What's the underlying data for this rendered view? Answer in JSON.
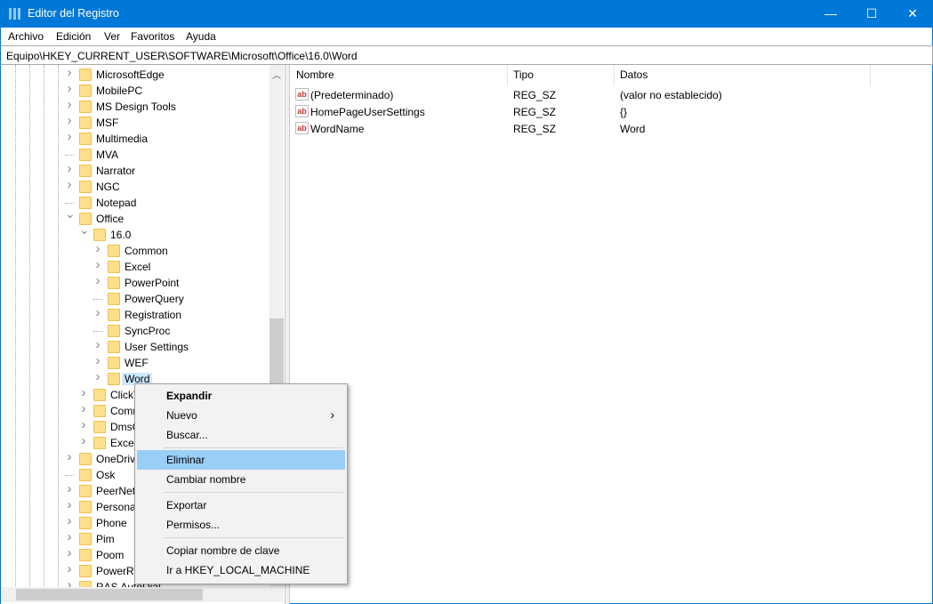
{
  "window": {
    "title": "Editor del Registro",
    "minimize": "—",
    "maximize": "☐",
    "close": "✕"
  },
  "menu": [
    "Archivo",
    "Edición",
    "Ver",
    "Favoritos",
    "Ayuda"
  ],
  "address": "Equipo\\HKEY_CURRENT_USER\\SOFTWARE\\Microsoft\\Office\\16.0\\Word",
  "tree": [
    {
      "label": "MicrosoftEdge",
      "level": 0,
      "exp": ">"
    },
    {
      "label": "MobilePC",
      "level": 0,
      "exp": ">"
    },
    {
      "label": "MS Design Tools",
      "level": 0,
      "exp": ">"
    },
    {
      "label": "MSF",
      "level": 0,
      "exp": ">"
    },
    {
      "label": "Multimedia",
      "level": 0,
      "exp": ">"
    },
    {
      "label": "MVA",
      "level": 0,
      "exp": ""
    },
    {
      "label": "Narrator",
      "level": 0,
      "exp": ">"
    },
    {
      "label": "NGC",
      "level": 0,
      "exp": ">"
    },
    {
      "label": "Notepad",
      "level": 0,
      "exp": ""
    },
    {
      "label": "Office",
      "level": 0,
      "exp": "v"
    },
    {
      "label": "16.0",
      "level": 1,
      "exp": "v"
    },
    {
      "label": "Common",
      "level": 2,
      "exp": ">"
    },
    {
      "label": "Excel",
      "level": 2,
      "exp": ">"
    },
    {
      "label": "PowerPoint",
      "level": 2,
      "exp": ">"
    },
    {
      "label": "PowerQuery",
      "level": 2,
      "exp": ""
    },
    {
      "label": "Registration",
      "level": 2,
      "exp": ">"
    },
    {
      "label": "SyncProc",
      "level": 2,
      "exp": ""
    },
    {
      "label": "User Settings",
      "level": 2,
      "exp": ">"
    },
    {
      "label": "WEF",
      "level": 2,
      "exp": ">"
    },
    {
      "label": "Word",
      "level": 2,
      "exp": ">",
      "selected": true
    },
    {
      "label": "ClickT",
      "level": 1,
      "exp": ">"
    },
    {
      "label": "Comm",
      "level": 1,
      "exp": ">"
    },
    {
      "label": "DmsC",
      "level": 1,
      "exp": ">"
    },
    {
      "label": "Excel",
      "level": 1,
      "exp": ">"
    },
    {
      "label": "OneDriv",
      "level": 0,
      "exp": ">"
    },
    {
      "label": "Osk",
      "level": 0,
      "exp": ""
    },
    {
      "label": "PeerNet",
      "level": 0,
      "exp": ">"
    },
    {
      "label": "Personal",
      "level": 0,
      "exp": ">"
    },
    {
      "label": "Phone",
      "level": 0,
      "exp": ">"
    },
    {
      "label": "Pim",
      "level": 0,
      "exp": ">"
    },
    {
      "label": "Poom",
      "level": 0,
      "exp": ">"
    },
    {
      "label": "PowerRe",
      "level": 0,
      "exp": ">"
    },
    {
      "label": "RAS AutoDial",
      "level": 0,
      "exp": ">"
    }
  ],
  "columns": {
    "name": "Nombre",
    "type": "Tipo",
    "data": "Datos"
  },
  "values": [
    {
      "name": "(Predeterminado)",
      "type": "REG_SZ",
      "data": "(valor no establecido)"
    },
    {
      "name": "HomePageUserSettings",
      "type": "REG_SZ",
      "data": "{}"
    },
    {
      "name": "WordName",
      "type": "REG_SZ",
      "data": "Word"
    }
  ],
  "value_icon": "ab",
  "context_menu": {
    "expand": "Expandir",
    "new": "Nuevo",
    "find": "Buscar...",
    "delete": "Eliminar",
    "rename": "Cambiar nombre",
    "export": "Exportar",
    "permissions": "Permisos...",
    "copy_key": "Copiar nombre de clave",
    "goto": "Ir a HKEY_LOCAL_MACHINE",
    "submenu_arrow": "›"
  }
}
